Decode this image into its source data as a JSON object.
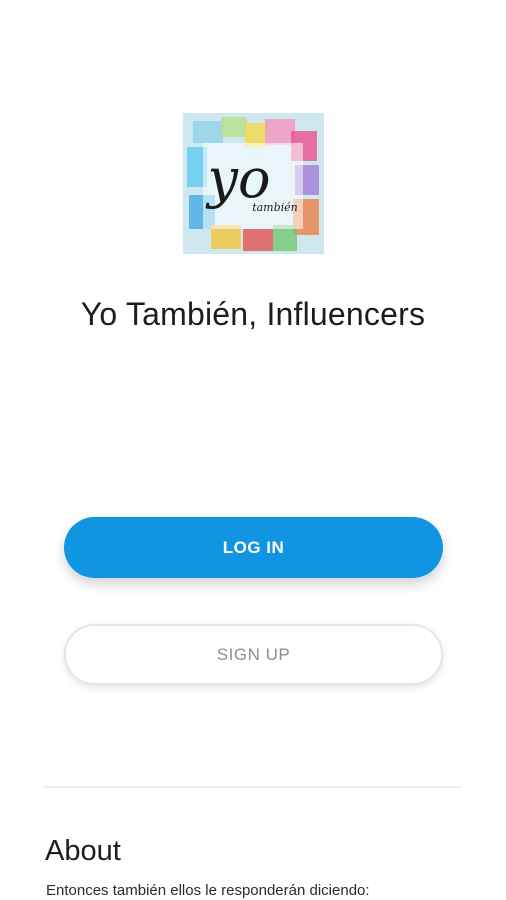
{
  "app": {
    "logo_text": "yo",
    "logo_subtext": "también",
    "title": "Yo También, Influencers"
  },
  "auth": {
    "login_label": "LOG IN",
    "signup_label": "SIGN UP"
  },
  "about": {
    "heading": "About",
    "text": "Entonces también ellos le responderán diciendo:"
  },
  "colors": {
    "primary": "#0f95e2",
    "background": "#ffffff"
  }
}
